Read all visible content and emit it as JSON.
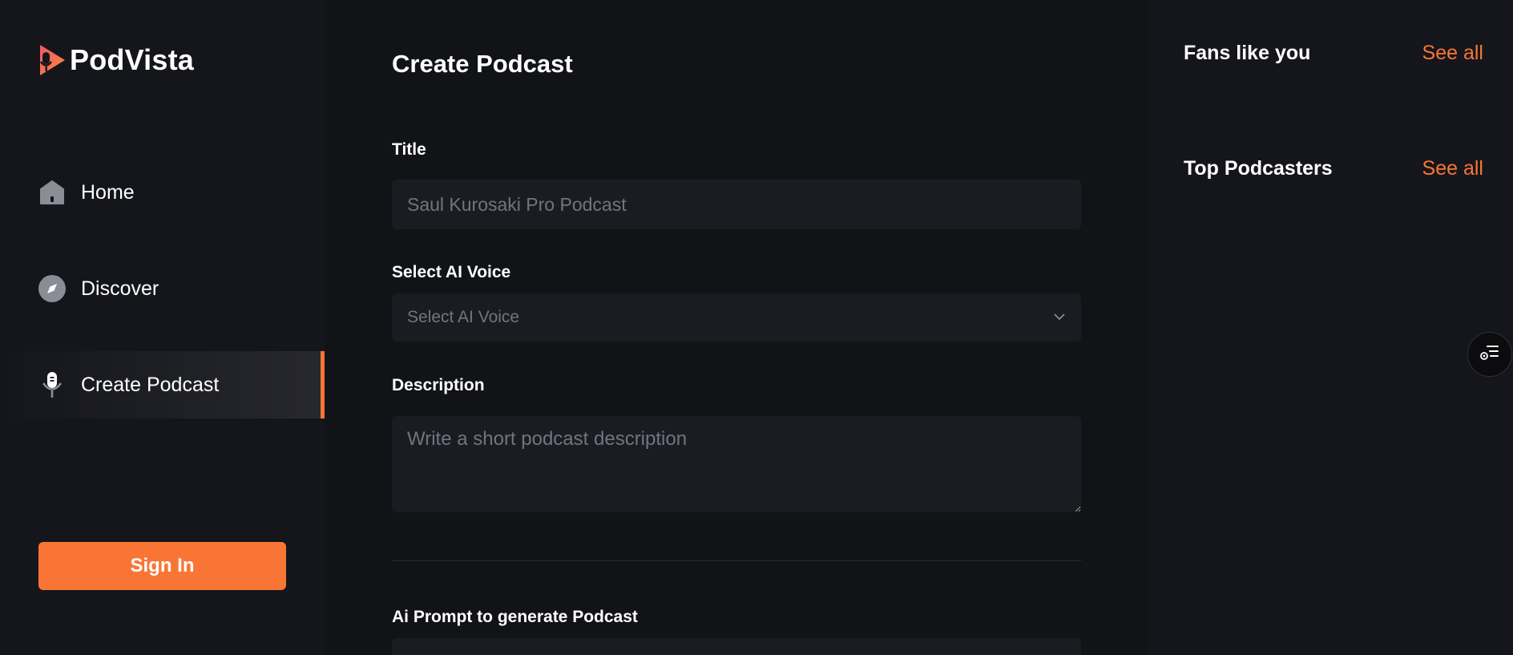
{
  "app": {
    "name": "PodVista",
    "accent_color": "#f97535",
    "logo_icon": "microphone-play-logo"
  },
  "sidebar": {
    "items": [
      {
        "label": "Home",
        "icon": "home-icon",
        "active": false
      },
      {
        "label": "Discover",
        "icon": "compass-icon",
        "active": false
      },
      {
        "label": "Create Podcast",
        "icon": "microphone-icon",
        "active": true
      }
    ],
    "sign_in_label": "Sign In"
  },
  "main": {
    "title": "Create Podcast",
    "fields": {
      "title_label": "Title",
      "title_placeholder": "Saul Kurosaki Pro Podcast",
      "voice_label": "Select AI Voice",
      "voice_value": "Select AI Voice",
      "description_label": "Description",
      "description_placeholder": "Write a short podcast description",
      "prompt_label": "Ai Prompt to generate Podcast"
    }
  },
  "rightbar": {
    "fans_title": "Fans like you",
    "fans_see_all": "See all",
    "podcasters_title": "Top Podcasters",
    "podcasters_see_all": "See all"
  },
  "floating": {
    "icon": "queue-list-icon"
  }
}
